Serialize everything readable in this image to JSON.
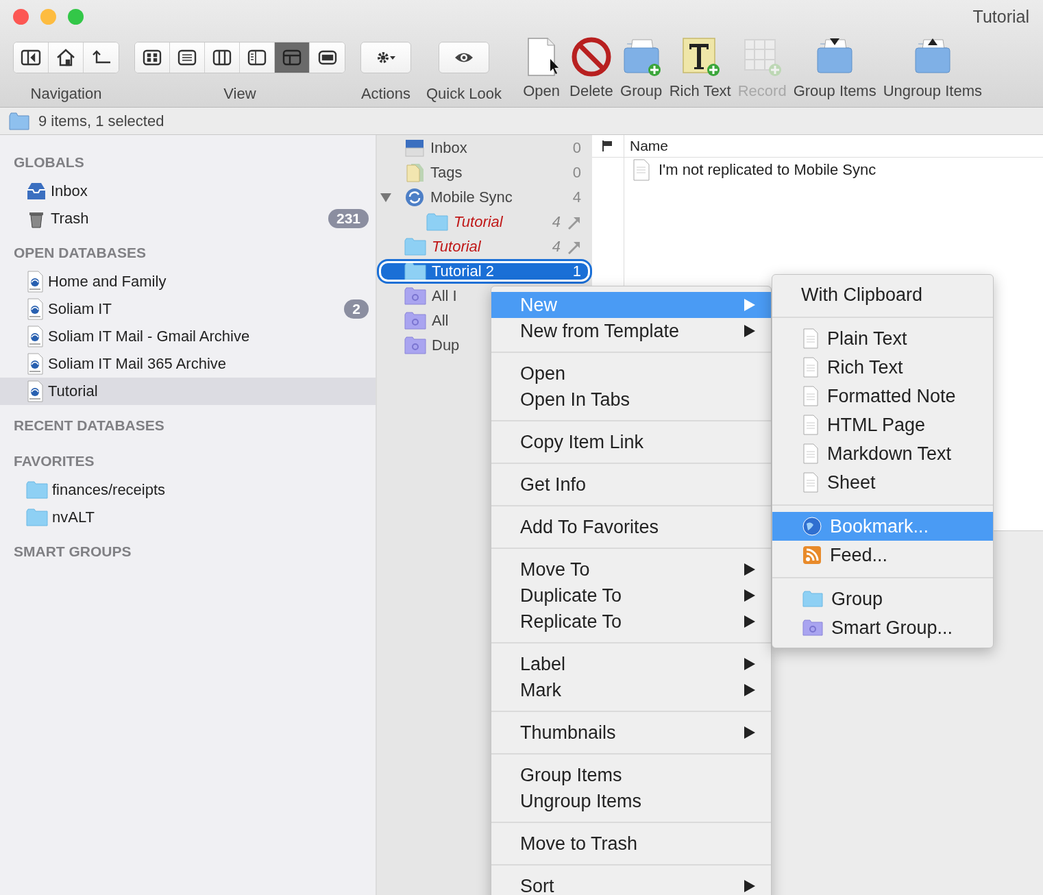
{
  "window": {
    "title": "Tutorial"
  },
  "toolbar": {
    "groups": [
      {
        "label": "Navigation",
        "segments": [
          {
            "selected": false
          },
          {
            "selected": false
          },
          {
            "selected": false
          }
        ]
      },
      {
        "label": "View",
        "segments": [
          {
            "selected": false
          },
          {
            "selected": false
          },
          {
            "selected": false
          },
          {
            "selected": false
          },
          {
            "selected": true
          },
          {
            "selected": false
          }
        ]
      },
      {
        "label": "Actions",
        "segments": [
          {
            "selected": false
          }
        ]
      },
      {
        "label": "Quick Look",
        "segments": [
          {
            "selected": false
          }
        ]
      }
    ],
    "buttons": [
      {
        "label": "Open",
        "disabled": false
      },
      {
        "label": "Delete",
        "disabled": false
      },
      {
        "label": "Group",
        "disabled": false
      },
      {
        "label": "Rich Text",
        "disabled": false
      },
      {
        "label": "Record",
        "disabled": true
      },
      {
        "label": "Group Items",
        "disabled": false
      },
      {
        "label": "Ungroup Items",
        "disabled": false
      }
    ]
  },
  "status_bar": {
    "text": "9 items, 1 selected"
  },
  "sidebar": {
    "sections": [
      {
        "title": "GLOBALS",
        "items": [
          {
            "kind": "inbox",
            "label": "Inbox",
            "selected": false
          },
          {
            "kind": "trash",
            "label": "Trash",
            "badge": "231",
            "selected": false
          }
        ]
      },
      {
        "title": "OPEN DATABASES",
        "items": [
          {
            "kind": "database",
            "label": "Home and Family",
            "selected": false
          },
          {
            "kind": "database",
            "label": "Soliam IT",
            "badge": "2",
            "selected": false
          },
          {
            "kind": "database",
            "label": "Soliam IT Mail - Gmail Archive",
            "selected": false
          },
          {
            "kind": "database",
            "label": "Soliam IT Mail 365 Archive",
            "selected": false
          },
          {
            "kind": "database",
            "label": "Tutorial",
            "selected": true
          }
        ]
      },
      {
        "title": "RECENT DATABASES"
      },
      {
        "title": "FAVORITES",
        "items": [
          {
            "kind": "folder",
            "label": "finances/receipts",
            "selected": false
          },
          {
            "kind": "folder",
            "label": "nvALT",
            "selected": false
          }
        ]
      },
      {
        "title": "SMART GROUPS"
      }
    ]
  },
  "group_list": {
    "items": [
      {
        "kind": "inbox",
        "label": "Inbox",
        "count": "0",
        "replicated": false,
        "selected": false
      },
      {
        "kind": "tags",
        "label": "Tags",
        "count": "0",
        "replicated": false,
        "selected": false
      },
      {
        "kind": "sync",
        "label": "Mobile Sync",
        "count": "4",
        "replicated": false,
        "selected": false,
        "expanded": true,
        "children": [
          {
            "kind": "folder",
            "label": "Tutorial",
            "count": "4",
            "replicated": true,
            "selected": false
          }
        ]
      },
      {
        "kind": "folder",
        "label": "Tutorial",
        "count": "4",
        "replicated": true,
        "selected": false
      },
      {
        "kind": "folder",
        "label": "Tutorial 2",
        "count": "1",
        "replicated": false,
        "selected": true
      },
      {
        "kind": "smart",
        "label": "All I",
        "replicated": false,
        "selected": false
      },
      {
        "kind": "smart",
        "label": "All",
        "replicated": false,
        "selected": false
      },
      {
        "kind": "smart",
        "label": "Dup",
        "replicated": false,
        "selected": false
      }
    ]
  },
  "document_list": {
    "columns": [
      "Name"
    ],
    "rows": [
      {
        "name": "I'm not replicated to Mobile Sync"
      }
    ]
  },
  "context_menu": {
    "sections": [
      [
        {
          "label": "New",
          "submenu": true,
          "selected": true
        },
        {
          "label": "New from Template",
          "submenu": true,
          "selected": false
        }
      ],
      [
        {
          "label": "Open",
          "submenu": false,
          "selected": false
        },
        {
          "label": "Open In Tabs",
          "submenu": false,
          "selected": false
        }
      ],
      [
        {
          "label": "Copy Item Link",
          "submenu": false,
          "selected": false
        }
      ],
      [
        {
          "label": "Get Info",
          "submenu": false,
          "selected": false
        }
      ],
      [
        {
          "label": "Add To Favorites",
          "submenu": false,
          "selected": false
        }
      ],
      [
        {
          "label": "Move To",
          "submenu": true,
          "selected": false
        },
        {
          "label": "Duplicate To",
          "submenu": true,
          "selected": false
        },
        {
          "label": "Replicate To",
          "submenu": true,
          "selected": false
        }
      ],
      [
        {
          "label": "Label",
          "submenu": true,
          "selected": false
        },
        {
          "label": "Mark",
          "submenu": true,
          "selected": false
        }
      ],
      [
        {
          "label": "Thumbnails",
          "submenu": true,
          "selected": false
        }
      ],
      [
        {
          "label": "Group Items",
          "submenu": false,
          "selected": false
        },
        {
          "label": "Ungroup Items",
          "submenu": false,
          "selected": false
        }
      ],
      [
        {
          "label": "Move to Trash",
          "submenu": false,
          "selected": false
        }
      ],
      [
        {
          "label": "Sort",
          "submenu": true,
          "selected": false
        }
      ]
    ]
  },
  "submenu": {
    "sections": [
      [
        {
          "kind": "plain",
          "label": "With Clipboard",
          "selected": false
        }
      ],
      [
        {
          "kind": "document",
          "label": "Plain Text",
          "selected": false
        },
        {
          "kind": "document",
          "label": "Rich Text",
          "selected": false
        },
        {
          "kind": "document",
          "label": "Formatted Note",
          "selected": false
        },
        {
          "kind": "document",
          "label": "HTML Page",
          "selected": false
        },
        {
          "kind": "document",
          "label": "Markdown Text",
          "selected": false
        },
        {
          "kind": "document",
          "label": "Sheet",
          "selected": false
        }
      ],
      [
        {
          "kind": "globe",
          "label": "Bookmark...",
          "selected": true
        },
        {
          "kind": "feed",
          "label": "Feed...",
          "selected": false
        }
      ],
      [
        {
          "kind": "folder",
          "label": "Group",
          "selected": false
        },
        {
          "kind": "smart",
          "label": "Smart Group...",
          "selected": false
        }
      ]
    ]
  }
}
